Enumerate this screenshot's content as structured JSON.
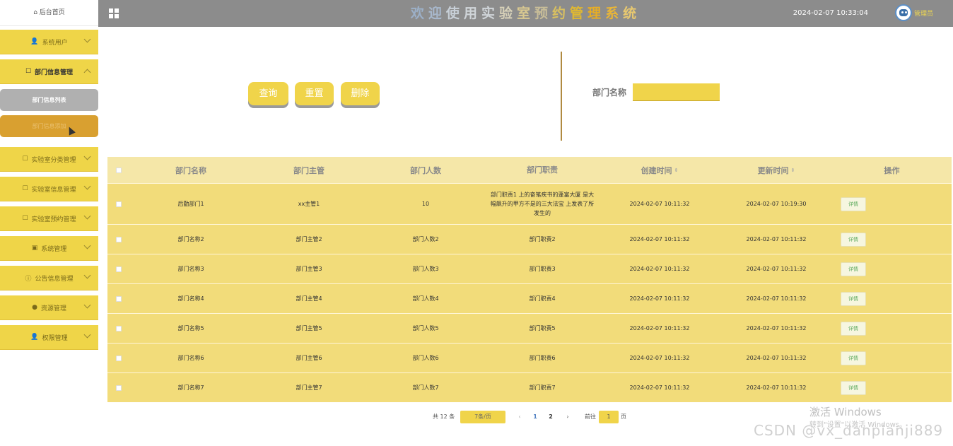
{
  "header": {
    "title": "欢迎使用实验室预约管理系统",
    "title_colors": [
      "#9cb0c8",
      "#a8b8cc",
      "#c8d0d8",
      "#cfd4d8",
      "#cfd4d8",
      "#d6d0b8",
      "#d8c890",
      "#c8bd98",
      "#d9c060",
      "#e0b830",
      "#e6ad26",
      "#e8b538",
      "#e8c870"
    ],
    "datetime": "2024-02-07 10:33:04",
    "username": "管理员"
  },
  "sidebar": {
    "home": "后台首页",
    "items": [
      {
        "label": "系统用户",
        "icon": "user-icon"
      },
      {
        "label": "部门信息管理",
        "icon": "edit-icon"
      },
      {
        "label": "实验室分类管理",
        "icon": "edit-icon"
      },
      {
        "label": "实验室信息管理",
        "icon": "edit-icon"
      },
      {
        "label": "实验室预约管理",
        "icon": "edit-icon"
      },
      {
        "label": "系统管理",
        "icon": "image-icon"
      },
      {
        "label": "公告信息管理",
        "icon": "info-icon"
      },
      {
        "label": "资源管理",
        "icon": "location-icon"
      },
      {
        "label": "权限管理",
        "icon": "user-icon"
      }
    ],
    "sub_items": [
      "部门信息列表",
      "部门信息添加"
    ]
  },
  "search": {
    "query_label": "查询",
    "reset_label": "重置",
    "delete_label": "删除",
    "field_label": "部门名称",
    "field_value": ""
  },
  "table": {
    "headers": {
      "name": "部门名称",
      "manager": "部门主管",
      "count": "部门人数",
      "duty": "部门职责",
      "created": "创建时间",
      "updated": "更新时间",
      "ops": "操作"
    },
    "detail_label": "详情",
    "rows": [
      {
        "name": "后勤部门1",
        "manager": "xx主管1",
        "count": "10",
        "duty": "部门职责1 上的奋笔疾书的蓬富大厦 是大幅飙升的甲方不是的三大法宝 上发表了所发生的",
        "created": "2024-02-07 10:11:32",
        "updated": "2024-02-07 10:19:30"
      },
      {
        "name": "部门名称2",
        "manager": "部门主管2",
        "count": "部门人数2",
        "duty": "部门职责2",
        "created": "2024-02-07 10:11:32",
        "updated": "2024-02-07 10:11:32"
      },
      {
        "name": "部门名称3",
        "manager": "部门主管3",
        "count": "部门人数3",
        "duty": "部门职责3",
        "created": "2024-02-07 10:11:32",
        "updated": "2024-02-07 10:11:32"
      },
      {
        "name": "部门名称4",
        "manager": "部门主管4",
        "count": "部门人数4",
        "duty": "部门职责4",
        "created": "2024-02-07 10:11:32",
        "updated": "2024-02-07 10:11:32"
      },
      {
        "name": "部门名称5",
        "manager": "部门主管5",
        "count": "部门人数5",
        "duty": "部门职责5",
        "created": "2024-02-07 10:11:32",
        "updated": "2024-02-07 10:11:32"
      },
      {
        "name": "部门名称6",
        "manager": "部门主管6",
        "count": "部门人数6",
        "duty": "部门职责6",
        "created": "2024-02-07 10:11:32",
        "updated": "2024-02-07 10:11:32"
      },
      {
        "name": "部门名称7",
        "manager": "部门主管7",
        "count": "部门人数7",
        "duty": "部门职责7",
        "created": "2024-02-07 10:11:32",
        "updated": "2024-02-07 10:11:32"
      }
    ]
  },
  "pagination": {
    "total": "共 12 条",
    "page_size": "7条/页",
    "prev": "‹",
    "page1": "1",
    "page2": "2",
    "next": "›",
    "goto": "前往",
    "goto_value": "1",
    "page_unit": "页"
  },
  "watermark": {
    "windows_title": "激活 Windows",
    "windows_sub": "转到\"设置\"以激活 Windows。",
    "csdn": "CSDN @vx_danpianji889"
  }
}
